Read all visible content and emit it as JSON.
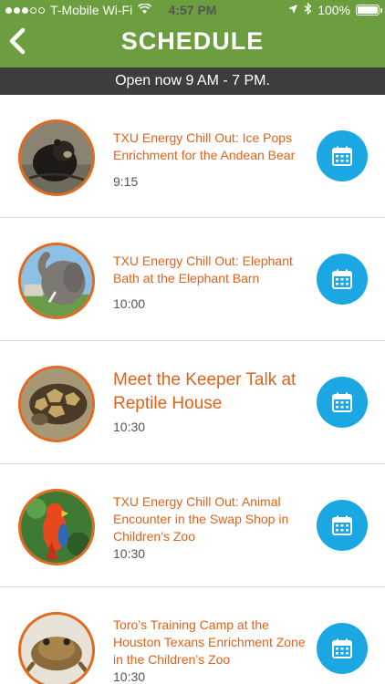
{
  "status_bar": {
    "carrier": "T-Mobile Wi-Fi",
    "time": "4:57 PM",
    "battery": "100%",
    "battery_level": 1.0,
    "signal_bars": 3,
    "icons": [
      "wifi-icon",
      "location-icon",
      "bluetooth-icon",
      "battery-icon"
    ]
  },
  "header": {
    "back_label": "<",
    "title": "SCHEDULE",
    "color": "#6c9e3f"
  },
  "hours_banner": {
    "text": "Open now 9 AM - 7 PM.",
    "color": "#3d3d3d"
  },
  "colors": {
    "accent": "#e0621a",
    "calendar_button": "#1aa7e4"
  },
  "events": [
    {
      "title": "TXU Energy Chill Out: Ice Pops Enrichment for the Andean Bear",
      "time": "9:15",
      "image": "andean-bear"
    },
    {
      "title": "TXU Energy Chill Out: Elephant Bath at the Elephant Barn",
      "time": "10:00",
      "image": "elephant"
    },
    {
      "title": "Meet the Keeper Talk at Reptile House",
      "time": "10:30",
      "image": "tortoise"
    },
    {
      "title": "TXU Energy Chill Out: Animal Encounter in the Swap Shop in Children’s Zoo",
      "time": "10:30",
      "image": "parrot"
    },
    {
      "title": "Toro’s Training Camp at the Houston Texans Enrichment Zone in the Children’s Zoo",
      "time": "10:30",
      "image": "toad"
    }
  ]
}
